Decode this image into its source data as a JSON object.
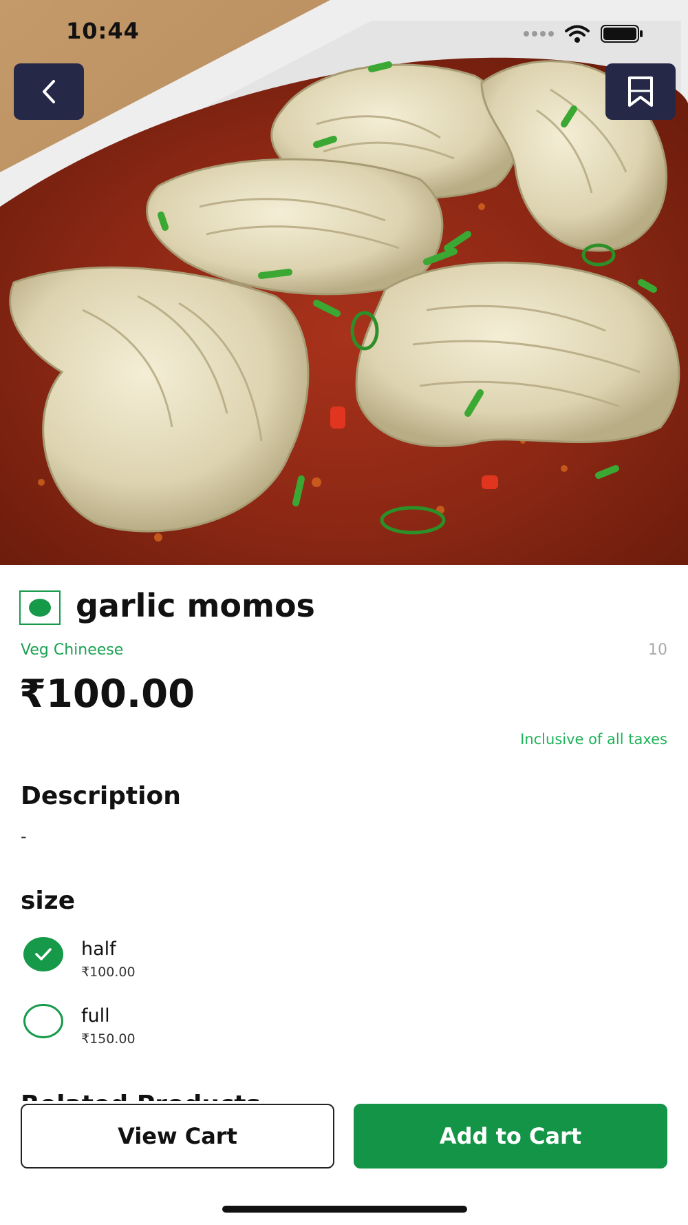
{
  "status_bar": {
    "time": "10:44"
  },
  "header": {
    "back_icon": "chevron-left-icon",
    "bookmark_icon": "bookmark-icon"
  },
  "product": {
    "title": "garlic momos",
    "veg_indicator": "veg-dot-icon",
    "category": "Veg Chineese",
    "count": "10",
    "price": "₹100.00",
    "tax_note": "Inclusive of all taxes"
  },
  "description": {
    "heading": "Description",
    "text": "-"
  },
  "size": {
    "heading": "size",
    "options": [
      {
        "label": "half",
        "price": "₹100.00",
        "selected": true
      },
      {
        "label": "full",
        "price": "₹150.00",
        "selected": false
      }
    ]
  },
  "related": {
    "heading": "Related Products"
  },
  "actions": {
    "view_cart": "View Cart",
    "add_to_cart": "Add to Cart"
  },
  "colors": {
    "accent": "#139446",
    "header_button": "#262848",
    "category_text": "#1aa152"
  }
}
